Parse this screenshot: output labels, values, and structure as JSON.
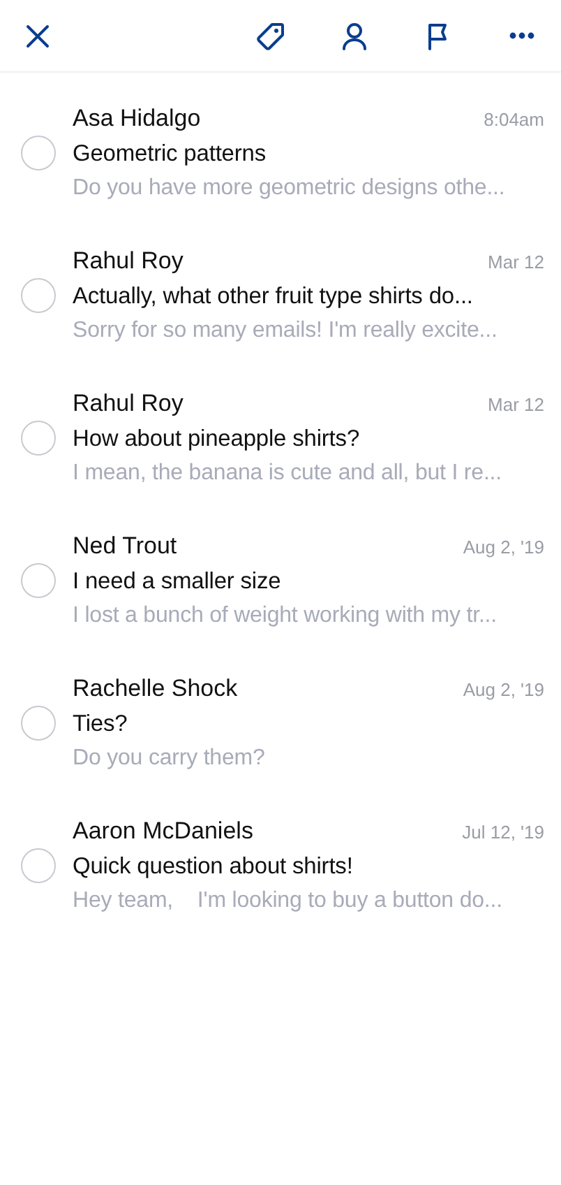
{
  "messages": [
    {
      "sender": "Asa Hidalgo",
      "time": "8:04am",
      "subject": "Geometric patterns",
      "preview": "Do you have more geometric designs othe...",
      "selected": false
    },
    {
      "sender": "Rahul Roy",
      "time": "Mar 12",
      "subject": "Actually, what other fruit type shirts do...",
      "preview": "Sorry for so many emails! I'm really excite...",
      "selected": false
    },
    {
      "sender": "Rahul Roy",
      "time": "Mar 12",
      "subject": "How about pineapple shirts?",
      "preview": "I mean, the banana is cute and all, but I re...",
      "selected": false
    },
    {
      "sender": "Ned Trout",
      "time": "Aug 2, '19",
      "subject": "I need a smaller size",
      "preview": "I lost a bunch of weight working with my tr...",
      "selected": false
    },
    {
      "sender": "Rachelle Shock",
      "time": "Aug 2, '19",
      "subject": "Ties?",
      "preview": "Do you carry them?",
      "selected": false
    },
    {
      "sender": "Aaron McDaniels",
      "time": "Jul 12, '19",
      "subject": "Quick question about shirts!",
      "preview": "Hey team,    I'm looking to buy a button do...",
      "selected": false
    }
  ]
}
